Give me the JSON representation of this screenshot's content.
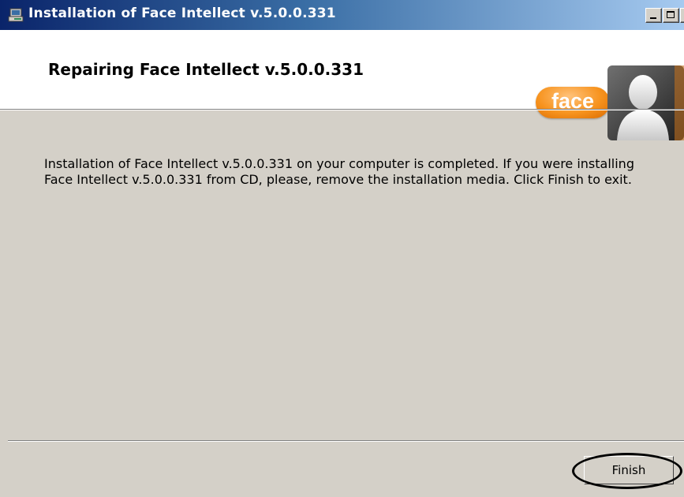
{
  "window": {
    "title": "Installation of Face Intellect v.5.0.0.331",
    "controls": [
      "minimize-icon",
      "maximize-icon",
      "close-icon"
    ]
  },
  "header": {
    "title": "Repairing Face Intellect v.5.0.0.331",
    "logo_text": "face"
  },
  "main": {
    "message": "Installation of Face Intellect v.5.0.0.331 on your computer is completed. If you were installing Face Intellect v.5.0.0.331 from CD, please, remove the installation media. Click Finish to exit."
  },
  "footer": {
    "finish_label": "Finish"
  },
  "colors": {
    "titlebar_start": "#0a246a",
    "titlebar_end": "#a6caf0",
    "dialog_background": "#d4d0c8",
    "logo_orange": "#f7931e"
  }
}
